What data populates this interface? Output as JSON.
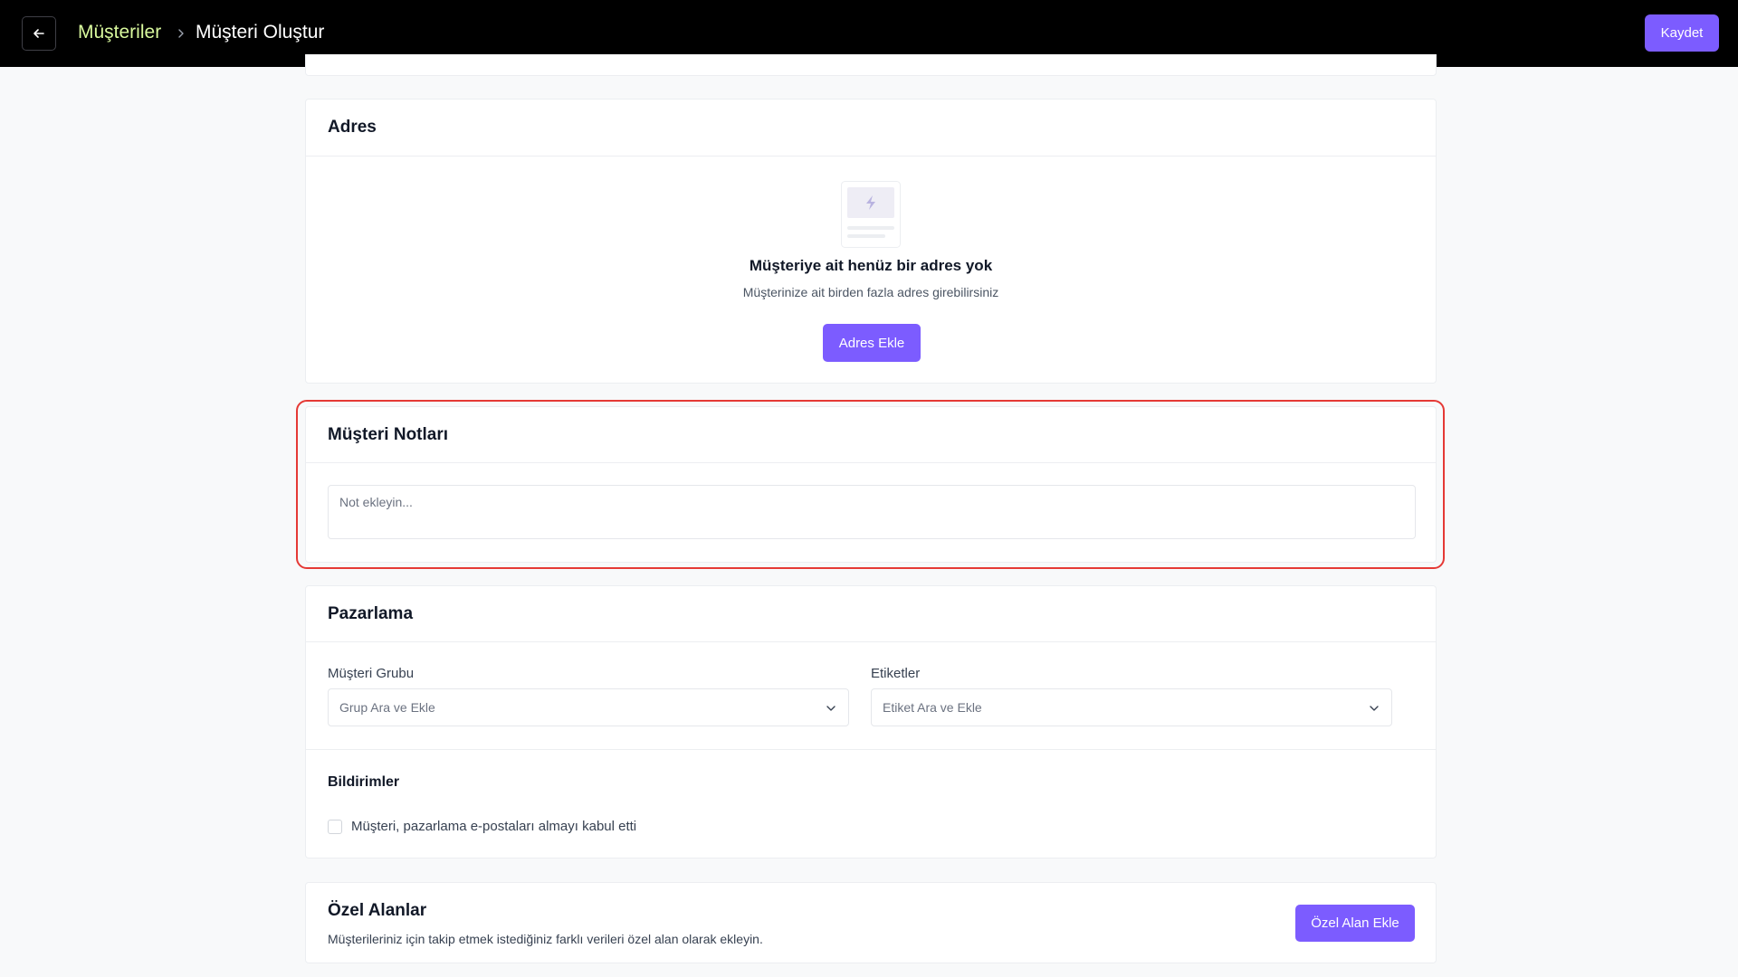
{
  "header": {
    "breadcrumb_parent": "Müşteriler",
    "breadcrumb_current": "Müşteri Oluştur",
    "save_label": "Kaydet"
  },
  "address": {
    "title": "Adres",
    "empty_title": "Müşteriye ait henüz bir adres yok",
    "empty_subtitle": "Müşterinize ait birden fazla adres girebilirsiniz",
    "add_button": "Adres Ekle"
  },
  "notes": {
    "title": "Müşteri Notları",
    "placeholder": "Not ekleyin...",
    "value": ""
  },
  "marketing": {
    "title": "Pazarlama",
    "group_label": "Müşteri Grubu",
    "group_placeholder": "Grup Ara ve Ekle",
    "tags_label": "Etiketler",
    "tags_placeholder": "Etiket Ara ve Ekle",
    "notifications_title": "Bildirimler",
    "email_consent_label": "Müşteri, pazarlama e-postaları almayı kabul etti",
    "email_consent_checked": false
  },
  "custom_fields": {
    "title": "Özel Alanlar",
    "subtitle": "Müşterileriniz için takip etmek istediğiniz farklı verileri özel alan olarak ekleyin.",
    "add_button": "Özel Alan Ekle"
  },
  "colors": {
    "accent": "#7c5cff",
    "breadcrumb_link": "#d9f99d",
    "highlight": "#e53935",
    "topbar": "#000000"
  }
}
